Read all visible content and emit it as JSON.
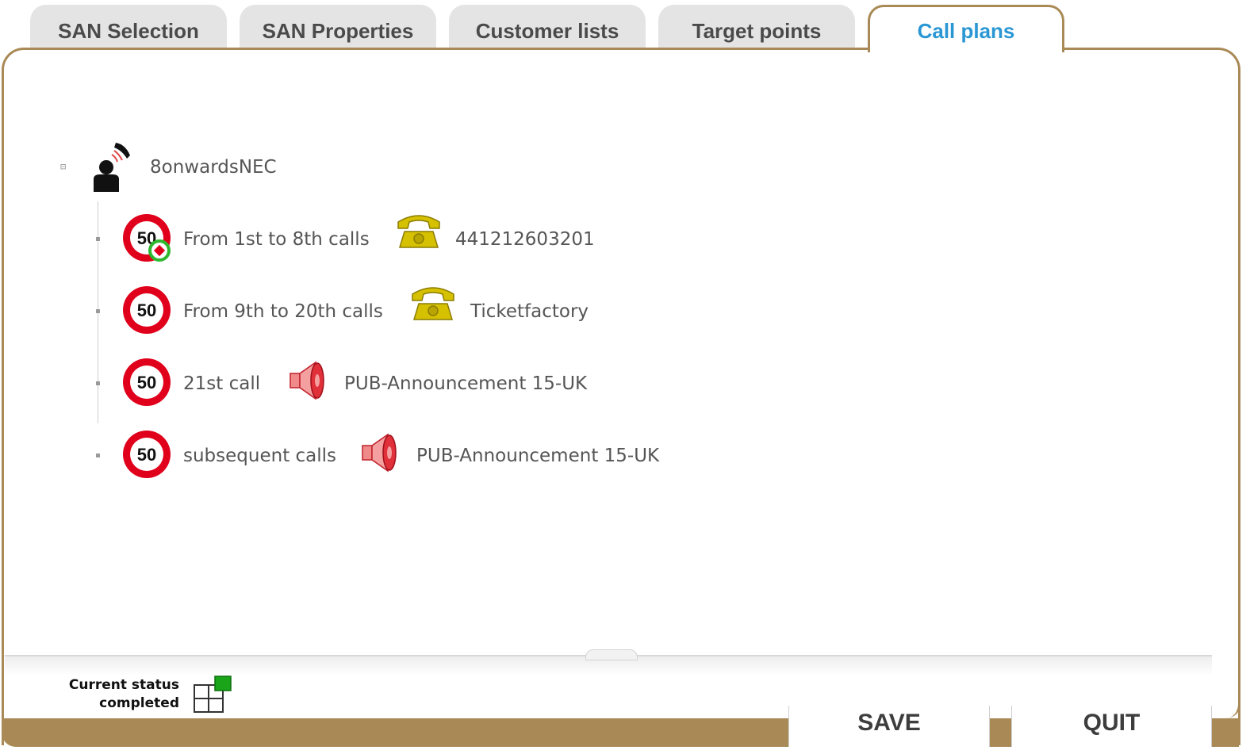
{
  "tabs": [
    {
      "label": "SAN Selection",
      "active": false
    },
    {
      "label": "SAN Properties",
      "active": false
    },
    {
      "label": "Customer lists",
      "active": false
    },
    {
      "label": "Target points",
      "active": false
    },
    {
      "label": "Call plans",
      "active": true
    }
  ],
  "tree": {
    "root": {
      "label": "8onwardsNEC",
      "icon": "caller-person-icon",
      "toggle": "⊟"
    },
    "items": [
      {
        "range": "From 1st to 8th calls",
        "range_icon": "speed-limit-50-refresh-icon",
        "target_icon": "phone-icon",
        "target": "441212603201"
      },
      {
        "range": "From 9th to 20th calls",
        "range_icon": "speed-limit-50-icon",
        "target_icon": "phone-icon",
        "target": "Ticketfactory"
      },
      {
        "range": "21st call",
        "range_icon": "speed-limit-50-icon",
        "target_icon": "speaker-icon",
        "target": "PUB-Announcement 15-UK"
      },
      {
        "range": "subsequent calls",
        "range_icon": "speed-limit-50-icon",
        "target_icon": "speaker-icon",
        "target": "PUB-Announcement 15-UK"
      }
    ],
    "sign_value": "50"
  },
  "status": {
    "line1": "Current status",
    "line2": "completed",
    "indicator_color": "#19a419"
  },
  "footer": {
    "save_label": "SAVE",
    "quit_label": "QUIT"
  },
  "colors": {
    "accent_border": "#a98a56",
    "active_tab_text": "#2a97d4",
    "phone": "#d6c100",
    "speaker": "#e0303a",
    "sign_red": "#e0001b"
  }
}
